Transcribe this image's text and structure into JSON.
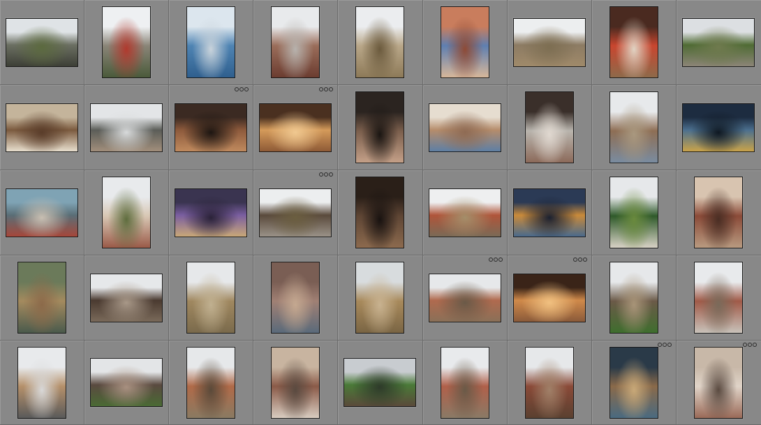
{
  "grid": {
    "columns": 9,
    "rows": 5,
    "background": "#7d7d7d",
    "cells": [
      {
        "orientation": "landscape",
        "palette": [
          "#dfe3e6",
          "#6b6f62",
          "#3d3f36",
          "#5c6a3f"
        ],
        "badge": false
      },
      {
        "orientation": "portrait",
        "palette": [
          "#eef0f2",
          "#8a8578",
          "#4a5a3a",
          "#b03a2e"
        ],
        "badge": false
      },
      {
        "orientation": "portrait",
        "palette": [
          "#dce6ee",
          "#4f84b3",
          "#2f5f8e",
          "#c9d3db"
        ],
        "badge": false
      },
      {
        "orientation": "portrait",
        "palette": [
          "#e8eaec",
          "#9a6d5a",
          "#6b3c30",
          "#b7b2ad"
        ],
        "badge": false
      },
      {
        "orientation": "portrait",
        "palette": [
          "#ebedef",
          "#b9a789",
          "#8d7a58",
          "#6b5a3d"
        ],
        "badge": false
      },
      {
        "orientation": "portrait",
        "palette": [
          "#c97d5d",
          "#5f7fb0",
          "#d7b79a",
          "#8e4b36"
        ],
        "badge": false
      },
      {
        "orientation": "landscape",
        "palette": [
          "#eceeef",
          "#8c7b63",
          "#a08a6a",
          "#7d6e52"
        ],
        "badge": false
      },
      {
        "orientation": "portrait",
        "palette": [
          "#4a2a20",
          "#c9462f",
          "#8e6a4a",
          "#e0d3c3"
        ],
        "badge": false
      },
      {
        "orientation": "landscape",
        "palette": [
          "#dcdfe2",
          "#4f6b34",
          "#8c8577",
          "#6f7a4e"
        ],
        "badge": false
      },
      {
        "orientation": "landscape",
        "palette": [
          "#c4b49b",
          "#7b5a3e",
          "#e8dfce",
          "#5a3d2a"
        ],
        "badge": false
      },
      {
        "orientation": "landscape",
        "palette": [
          "#e3e5e7",
          "#5b5d58",
          "#a28f7c",
          "#d8dadb"
        ],
        "badge": false
      },
      {
        "orientation": "landscape",
        "palette": [
          "#3b2a22",
          "#8d5a3c",
          "#c08a5e",
          "#1d1612"
        ],
        "badge": true
      },
      {
        "orientation": "landscape",
        "palette": [
          "#4a3020",
          "#d49a5a",
          "#8e5a36",
          "#f0c890"
        ],
        "badge": true
      },
      {
        "orientation": "portrait",
        "palette": [
          "#2b2420",
          "#7a5e4c",
          "#c4a088",
          "#1a1512"
        ],
        "badge": false
      },
      {
        "orientation": "landscape",
        "palette": [
          "#e6ddd0",
          "#b58c6b",
          "#5e7fa4",
          "#8f6b54"
        ],
        "badge": false
      },
      {
        "orientation": "portrait",
        "palette": [
          "#3a2f2a",
          "#b9b5ae",
          "#8c6a5a",
          "#e0d8d0"
        ],
        "badge": false
      },
      {
        "orientation": "portrait",
        "palette": [
          "#e7e9eb",
          "#8e6e54",
          "#7a8ca0",
          "#a9987f"
        ],
        "badge": false
      },
      {
        "orientation": "landscape",
        "palette": [
          "#1d2c40",
          "#4b6f8e",
          "#c9a34a",
          "#0f1822"
        ],
        "badge": false
      },
      {
        "orientation": "landscape",
        "palette": [
          "#7fa3b4",
          "#5a6e76",
          "#a6473a",
          "#c8bfb2"
        ],
        "badge": false
      },
      {
        "orientation": "portrait",
        "palette": [
          "#e8eaec",
          "#d8c7b4",
          "#9a5a48",
          "#5f6d3e"
        ],
        "badge": false
      },
      {
        "orientation": "landscape",
        "palette": [
          "#3a3450",
          "#7a5ea0",
          "#c9a878",
          "#2a2238"
        ],
        "badge": false
      },
      {
        "orientation": "landscape",
        "palette": [
          "#eceeef",
          "#5a4a3c",
          "#9a9288",
          "#6b5e40"
        ],
        "badge": true
      },
      {
        "orientation": "portrait",
        "palette": [
          "#2a1f18",
          "#5e4534",
          "#8c6a4e",
          "#181210"
        ],
        "badge": false
      },
      {
        "orientation": "landscape",
        "palette": [
          "#eeeff0",
          "#b0553a",
          "#7a6a56",
          "#a48e6a"
        ],
        "badge": false
      },
      {
        "orientation": "landscape",
        "palette": [
          "#2b3a55",
          "#c98a3a",
          "#4a6a8c",
          "#1a2030"
        ],
        "badge": false
      },
      {
        "orientation": "portrait",
        "palette": [
          "#e6e8ea",
          "#2f5a2a",
          "#d8d2c6",
          "#6a8a3e"
        ],
        "badge": false
      },
      {
        "orientation": "portrait",
        "palette": [
          "#d8c4b0",
          "#8a4a38",
          "#b89a80",
          "#4a2e24"
        ],
        "badge": false
      },
      {
        "orientation": "portrait",
        "palette": [
          "#6b7a5a",
          "#a48a5e",
          "#4a5a4c",
          "#8c6a4a"
        ],
        "badge": false
      },
      {
        "orientation": "landscape",
        "palette": [
          "#e6e8ea",
          "#4a3a30",
          "#7a6a5a",
          "#a89888"
        ],
        "badge": false
      },
      {
        "orientation": "portrait",
        "palette": [
          "#e6e8ea",
          "#a08860",
          "#7a6a4c",
          "#c0b090"
        ],
        "badge": false
      },
      {
        "orientation": "portrait",
        "palette": [
          "#7a5e54",
          "#a08074",
          "#5a6a7a",
          "#c4a890"
        ],
        "badge": false
      },
      {
        "orientation": "portrait",
        "palette": [
          "#d8dcde",
          "#a88a5c",
          "#7a6544",
          "#c8b290"
        ],
        "badge": false
      },
      {
        "orientation": "landscape",
        "palette": [
          "#e6e8ea",
          "#b06a4e",
          "#8a7058",
          "#6a5a48"
        ],
        "badge": true
      },
      {
        "orientation": "landscape",
        "palette": [
          "#3a2418",
          "#d08a4a",
          "#8a5a3a",
          "#f0c080"
        ],
        "badge": true
      },
      {
        "orientation": "portrait",
        "palette": [
          "#e6e8ea",
          "#6b5a48",
          "#3f6e2e",
          "#a89478"
        ],
        "badge": false
      },
      {
        "orientation": "portrait",
        "palette": [
          "#e8eaec",
          "#a05a48",
          "#c8c2ba",
          "#7a6a5a"
        ],
        "badge": false
      },
      {
        "orientation": "portrait",
        "palette": [
          "#e8eaec",
          "#b5906a",
          "#5a5a5a",
          "#d8d8d8"
        ],
        "badge": false
      },
      {
        "orientation": "landscape",
        "palette": [
          "#e3e5e7",
          "#5a4a40",
          "#4a6a34",
          "#a89080"
        ],
        "badge": false
      },
      {
        "orientation": "portrait",
        "palette": [
          "#e6e8ea",
          "#b06a48",
          "#8a7a62",
          "#5a4a3a"
        ],
        "badge": false
      },
      {
        "orientation": "portrait",
        "palette": [
          "#c8b4a0",
          "#8a5a48",
          "#d8ccc0",
          "#5a4a40"
        ],
        "badge": false
      },
      {
        "orientation": "landscape",
        "palette": [
          "#c8ccd0",
          "#4a7a38",
          "#5a4a3a",
          "#2e3a2a"
        ],
        "badge": false
      },
      {
        "orientation": "portrait",
        "palette": [
          "#e8eaec",
          "#b0604a",
          "#8a7a66",
          "#6a5a48"
        ],
        "badge": false
      },
      {
        "orientation": "portrait",
        "palette": [
          "#e6e8ea",
          "#8a4a38",
          "#5a4030",
          "#a08068"
        ],
        "badge": false
      },
      {
        "orientation": "portrait",
        "palette": [
          "#2a3a48",
          "#8a6a4a",
          "#4a6a80",
          "#c8a878"
        ],
        "badge": true
      },
      {
        "orientation": "portrait",
        "palette": [
          "#c8b8a8",
          "#e0d4c8",
          "#9a6a58",
          "#5a4a40"
        ],
        "badge": true
      }
    ]
  }
}
